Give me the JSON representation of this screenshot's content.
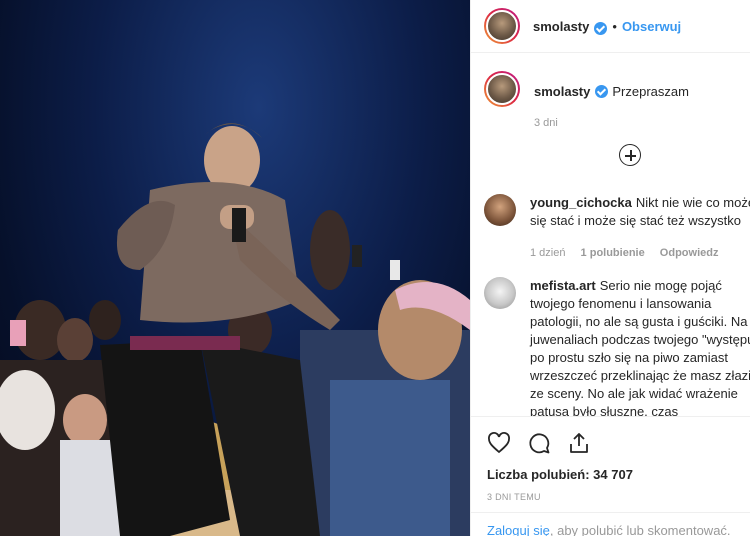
{
  "post": {
    "username": "smolasty",
    "follow_label": "Obserwuj",
    "dot": "•"
  },
  "caption": {
    "username": "smolasty",
    "text": "Przepraszam",
    "time": "3 dni"
  },
  "comments": [
    {
      "username": "young_cichocka",
      "text": "Nikt nie wie co może się stać i może się stać też wszystko",
      "time": "1 dzień",
      "likes": "1 polubienie",
      "reply": "Odpowiedz"
    },
    {
      "username": "mefista.art",
      "text": "Serio nie mogę pojąć twojego fenomenu i lansowania patologii, no ale są gusta i guściki. Na juwenaliach podczas twojego \"występu\" po prostu szło się na piwo zamiast wrzeszczeć przeklinając że masz złazić ze sceny. No ale jak widać wrażenie patusa było słuszne, czas"
    }
  ],
  "actions": {
    "likes_label": "Liczba polubień: 34 707",
    "time_ago": "3 DNI TEMU"
  },
  "login": {
    "link": "Zaloguj się",
    "text": ", aby polubić lub skomentować."
  },
  "icons": [
    "heart-icon",
    "comment-icon",
    "share-icon",
    "plus-circle-icon",
    "verified-badge-icon"
  ],
  "colors": {
    "link": "#3897f0",
    "muted": "#999999",
    "text": "#262626",
    "verified": "#3897f0"
  }
}
